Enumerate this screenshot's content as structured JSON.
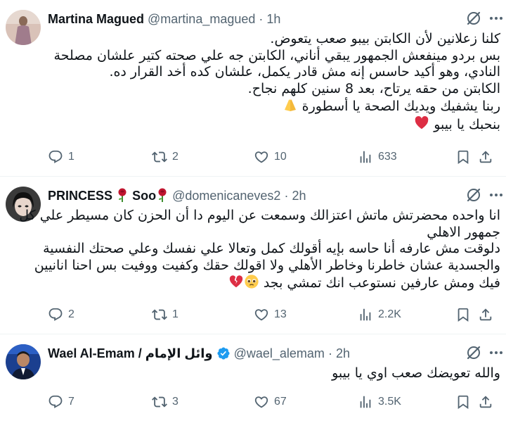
{
  "tweets": [
    {
      "name": "Martina Magued",
      "handle": "@martina_magued",
      "time": "1h",
      "lines": [
        "كلنا زعلانين لأن الكابتن بيبو صعب يتعوض.",
        "بس بردو مينفعش الجمهور يبقي أناني، الكابتن جه علي صحته كتير علشان مصلحة",
        "النادي، وهو أكيد حاسس إنه مش قادر يكمل، علشان كده أخد القرار ده.",
        "الكابتن من حقه يرتاح، بعد 8 سنين كلهم نجاح.",
        "ربنا يشفيك ويديك الصحة يا أسطورة",
        "بنحبك يا بيبو"
      ],
      "replies": "1",
      "reposts": "2",
      "likes": "10",
      "views": "633"
    },
    {
      "name": "PRINCESS",
      "name_suffix": "Soo",
      "handle": "@domenicaneves2",
      "time": "2h",
      "lines": [
        "انا واحده محضرتش ماتش اعتزالك وسمعت عن اليوم دا أن الحزن كان مسيطر علي كل",
        "جمهور الاهلي",
        "دلوقت مش عارفه أنا حاسه بإيه أقولك كمل وتعالا علي نفسك وعلي صحتك النفسية",
        "والجسدية عشان خاطرنا وخاطر الأهلي ولا اقولك حقك وكفيت ووفيت بس احنا انانيين",
        "فيك ومش عارفين نستوعب انك تمشي بجد"
      ],
      "replies": "2",
      "reposts": "1",
      "likes": "13",
      "views": "2.2K"
    },
    {
      "name": "Wael Al-Emam / وائل الإمام",
      "handle": "@wael_alemam",
      "time": "2h",
      "lines": [
        "والله تعويضك صعب اوي يا بيبو"
      ],
      "replies": "7",
      "reposts": "3",
      "likes": "67",
      "views": "3.5K"
    }
  ],
  "icons": {
    "reply": "reply-icon",
    "repost": "repost-icon",
    "like": "like-icon",
    "views": "views-icon",
    "bookmark": "bookmark-icon",
    "share": "share-icon",
    "grok": "grok-icon",
    "more": "more-icon"
  },
  "colors": {
    "text": "#0f1419",
    "secondary": "#536471",
    "verified": "#1d9bf0",
    "divider": "#eff3f4",
    "heart": "#e0245e",
    "rose": "#c0152f"
  }
}
